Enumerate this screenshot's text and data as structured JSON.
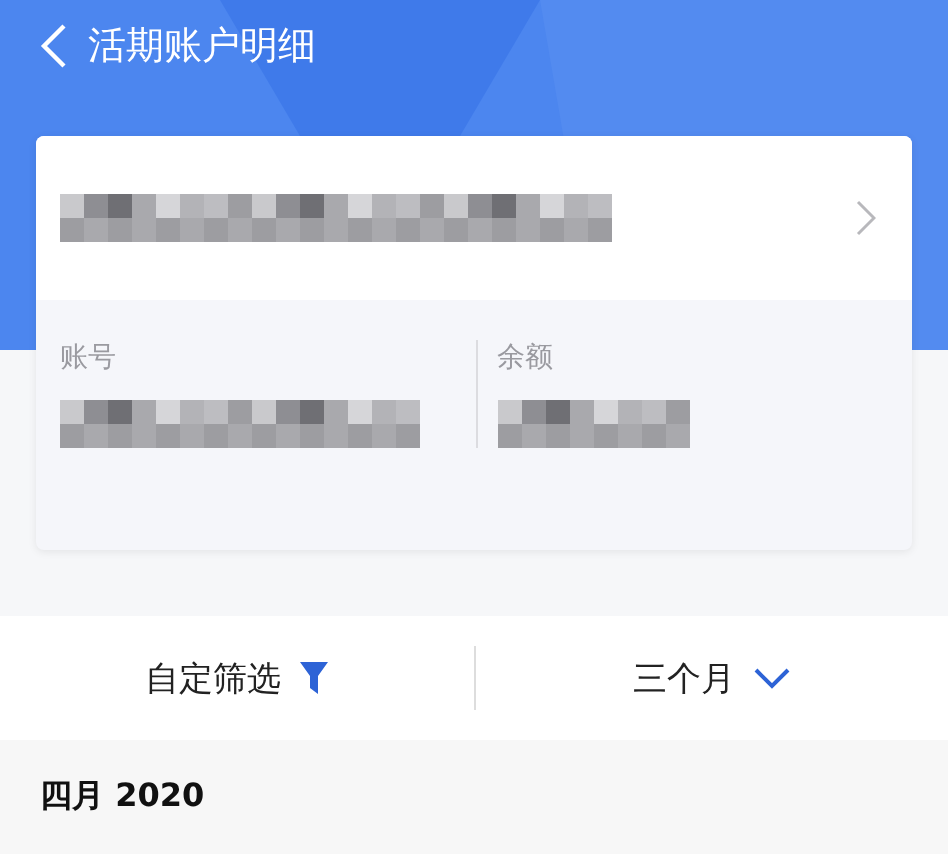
{
  "header": {
    "title": "活期账户明细"
  },
  "account_card": {
    "account_label": "账号",
    "balance_label": "余额"
  },
  "filter_bar": {
    "custom_filter": "自定筛选",
    "period": "三个月"
  },
  "month_section": {
    "title": "四月 2020"
  }
}
